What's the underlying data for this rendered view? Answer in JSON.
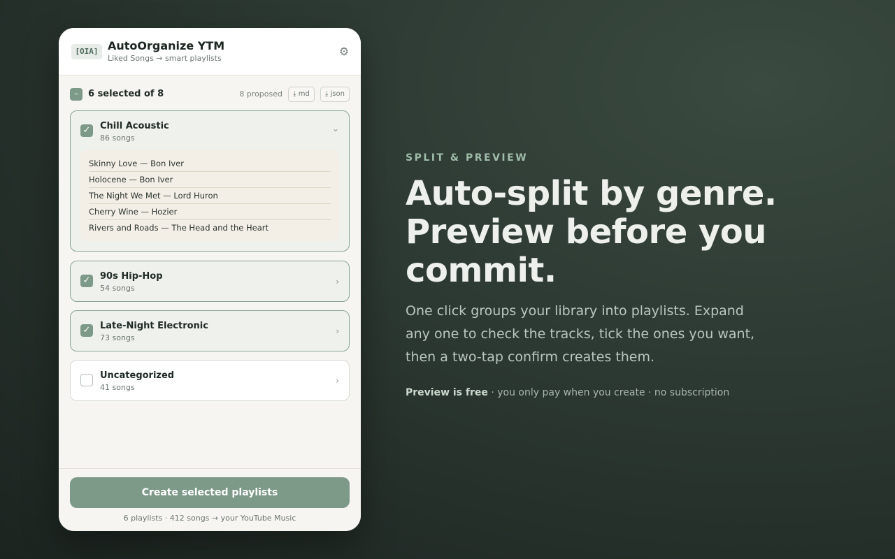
{
  "app": {
    "logo": "[OIA]",
    "title": "AutoOrganize YTM",
    "subtitle": "Liked Songs → smart playlists",
    "settings_icon": "gear-icon"
  },
  "selection": {
    "summary": "6 selected of 8",
    "proposed": "8 proposed",
    "export_md": "⤓ md",
    "export_json": "⤓ json"
  },
  "playlists": [
    {
      "name": "Chill Acoustic",
      "count": "86 songs",
      "checked": true,
      "expanded": true,
      "tracks": [
        "Skinny Love — Bon Iver",
        "Holocene — Bon Iver",
        "The Night We Met — Lord Huron",
        "Cherry Wine — Hozier",
        "Rivers and Roads — The Head and the Heart"
      ]
    },
    {
      "name": "90s Hip-Hop",
      "count": "54 songs",
      "checked": true,
      "expanded": false
    },
    {
      "name": "Late-Night Electronic",
      "count": "73 songs",
      "checked": true,
      "expanded": false
    },
    {
      "name": "Uncategorized",
      "count": "41 songs",
      "checked": false,
      "expanded": false
    }
  ],
  "footer": {
    "create_label": "Create selected playlists",
    "note": "6 playlists · 412 songs → your YouTube Music"
  },
  "hero": {
    "eyebrow": "SPLIT & PREVIEW",
    "headline": "Auto-split by genre. Preview before you commit.",
    "description": "One click groups your library into playlists. Expand any one to check the tracks, tick the ones you want, then a two-tap confirm creates them.",
    "pricing_bold": "Preview is free",
    "pricing_rest": " · you only pay when you create · no subscription"
  },
  "colors": {
    "accent": "#7d9a88",
    "background": "#2c3832",
    "panel": "#f7f5f1"
  }
}
